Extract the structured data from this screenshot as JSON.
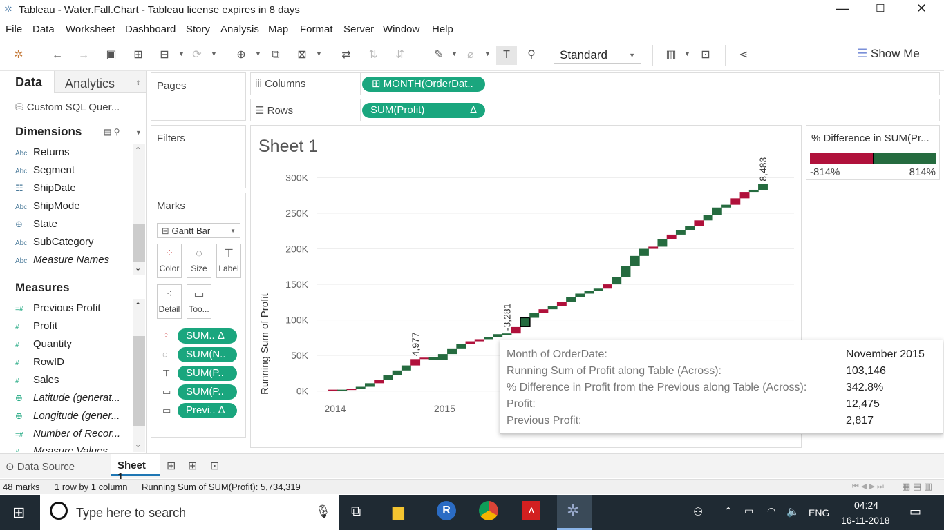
{
  "titlebar": {
    "title": "Tableau - Water.Fall.Chart - Tableau license expires in 8 days"
  },
  "menu": [
    "File",
    "Data",
    "Worksheet",
    "Dashboard",
    "Story",
    "Analysis",
    "Map",
    "Format",
    "Server",
    "Window",
    "Help"
  ],
  "toolbar": {
    "standard": "Standard",
    "show_me": "Show Me"
  },
  "leftpane": {
    "tab_data": "Data",
    "tab_analytics": "Analytics",
    "datasource": "Custom SQL Quer...",
    "dimensions_header": "Dimensions",
    "dimensions": [
      {
        "icon": "Abc",
        "label": "Returns"
      },
      {
        "icon": "Abc",
        "label": "Segment"
      },
      {
        "icon": "cal",
        "label": "ShipDate"
      },
      {
        "icon": "Abc",
        "label": "ShipMode"
      },
      {
        "icon": "globe",
        "label": "State"
      },
      {
        "icon": "Abc",
        "label": "SubCategory"
      },
      {
        "icon": "Abc",
        "label": "Measure Names"
      }
    ],
    "measures_header": "Measures",
    "measures": [
      {
        "icon": "=#",
        "label": "Previous Profit"
      },
      {
        "icon": "#",
        "label": "Profit"
      },
      {
        "icon": "#",
        "label": "Quantity"
      },
      {
        "icon": "#",
        "label": "RowID"
      },
      {
        "icon": "#",
        "label": "Sales"
      },
      {
        "icon": "globe",
        "label": "Latitude (generat..."
      },
      {
        "icon": "globe",
        "label": "Longitude (gener..."
      },
      {
        "icon": "=#",
        "label": "Number of Recor..."
      },
      {
        "icon": "#",
        "label": "Measure Values"
      }
    ]
  },
  "shelves": {
    "pages": "Pages",
    "filters": "Filters",
    "marks": "Marks",
    "columns_label": "Columns",
    "rows_label": "Rows",
    "columns_pill": "MONTH(OrderDat..",
    "rows_pill": "SUM(Profit)",
    "rows_delta": "Δ",
    "mark_type": "Gantt Bar",
    "mark_buttons": [
      "Color",
      "Size",
      "Label",
      "Detail",
      "Too..."
    ],
    "mark_pills": [
      "SUM.. Δ",
      "SUM(N..",
      "SUM(P..",
      "SUM(P..",
      "Previ.. Δ"
    ]
  },
  "sheet": {
    "title": "Sheet 1",
    "legend_title": "% Difference in SUM(Pr...",
    "legend_min": "-814%",
    "legend_max": "814%"
  },
  "chart_data": {
    "type": "waterfall",
    "ylabel": "Running Sum of Profit",
    "xlabel": "",
    "yticks": [
      "300K",
      "250K",
      "200K",
      "150K",
      "100K",
      "50K",
      "0K"
    ],
    "xticks": [
      "2014",
      "2015"
    ],
    "ylim": [
      -10000,
      315000
    ],
    "colors": {
      "positive": "#256b3f",
      "negative": "#b0113b"
    },
    "data_labels": [
      "4,977",
      "-3,281",
      "8,483"
    ],
    "running_sum": [
      2000,
      1500,
      3500,
      6000,
      11000,
      16000,
      22000,
      29000,
      36000,
      45000,
      47000,
      44000,
      52000,
      60000,
      66000,
      70000,
      73000,
      76000,
      80000,
      81000,
      90000,
      103146,
      110000,
      115000,
      120000,
      125000,
      132000,
      137000,
      141000,
      144000,
      150000,
      160000,
      176000,
      190000,
      200000,
      203000,
      214000,
      220000,
      226000,
      232000,
      240000,
      248000,
      258000,
      262000,
      271000,
      280000,
      283000,
      291000
    ],
    "profit": [
      2000,
      -500,
      2000,
      2500,
      5000,
      5000,
      6000,
      7000,
      7000,
      9000,
      2000,
      -3281,
      8000,
      8000,
      6000,
      4000,
      3000,
      3000,
      4000,
      1000,
      9000,
      12475,
      7000,
      5000,
      5000,
      5000,
      7000,
      5000,
      4000,
      3000,
      6000,
      10000,
      16000,
      14000,
      10000,
      3000,
      11000,
      6000,
      6000,
      6000,
      8000,
      8000,
      10000,
      4000,
      9000,
      9000,
      3000,
      8483
    ]
  },
  "tooltip": {
    "rows": [
      {
        "k": "Month of OrderDate:",
        "v": "November 2015"
      },
      {
        "k": "Running Sum of Profit along Table (Across):",
        "v": "103,146"
      },
      {
        "k": "% Difference in Profit from the Previous along Table (Across):",
        "v": "342.8%"
      },
      {
        "k": "Profit:",
        "v": "12,475"
      },
      {
        "k": "Previous Profit:",
        "v": "2,817"
      }
    ]
  },
  "tabs": {
    "datasource": "Data Source",
    "sheet1": "Sheet 1"
  },
  "status": {
    "marks": "48 marks",
    "rows": "1 row by 1 column",
    "sum": "Running Sum of SUM(Profit): 5,734,319"
  },
  "taskbar": {
    "search": "Type here to search",
    "lang": "ENG",
    "time": "04:24",
    "date": "16-11-2018"
  }
}
